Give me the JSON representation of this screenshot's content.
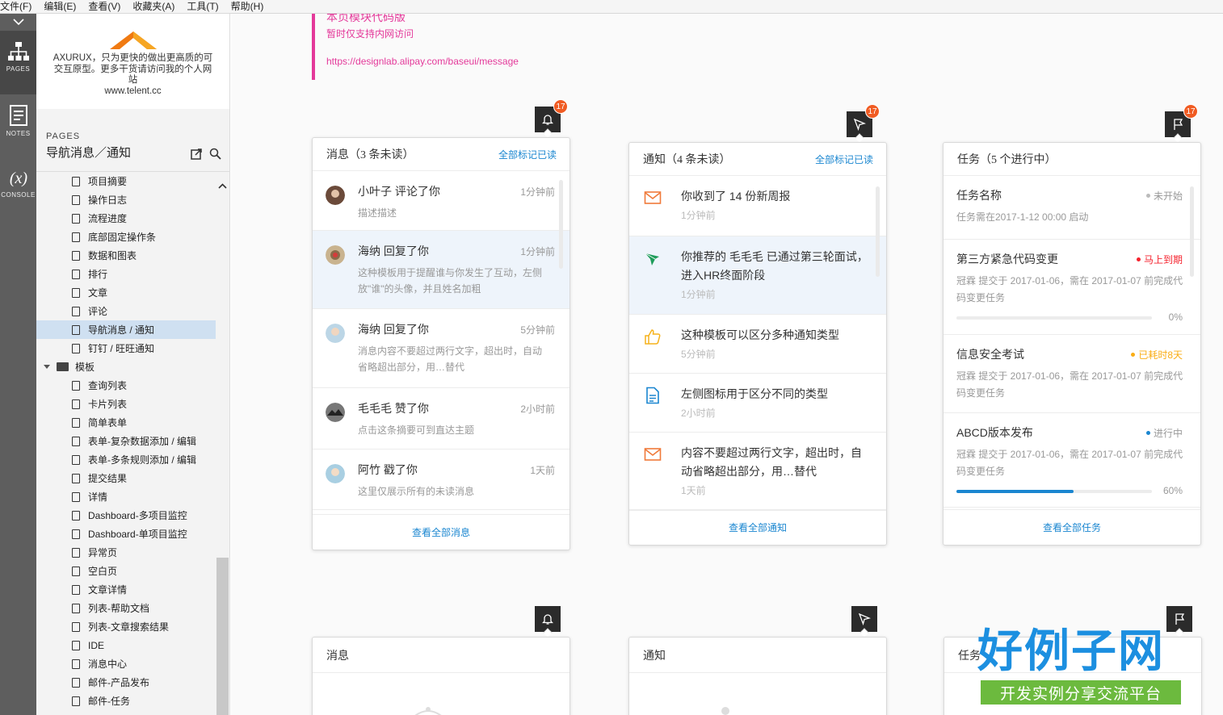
{
  "menubar": {
    "items": [
      "文件(F)",
      "编辑(E)",
      "查看(V)",
      "收藏夹(A)",
      "工具(T)",
      "帮助(H)"
    ]
  },
  "tools": {
    "pages": "PAGES",
    "notes": "NOTES",
    "console": "CONSOLE"
  },
  "brand": {
    "desc": "AXURUX，只为更快的做出更高质的可交互原型。更多干货请访问我的个人网站",
    "site": "www.telent.cc"
  },
  "pages": {
    "label": "PAGES",
    "title": "导航消息／通知"
  },
  "tree": {
    "items": [
      "项目摘要",
      "操作日志",
      "流程进度",
      "底部固定操作条",
      "数据和图表",
      "排行",
      "文章",
      "评论",
      "导航消息 / 通知",
      "钉钉 / 旺旺通知"
    ],
    "folder": "模板",
    "items2": [
      "查询列表",
      "卡片列表",
      "简单表单",
      "表单-复杂数据添加 / 编辑",
      "表单-多条规则添加 / 编辑",
      "提交结果",
      "详情",
      "Dashboard-多项目监控",
      "Dashboard-单项目监控",
      "异常页",
      "空白页",
      "文章详情",
      "列表-帮助文档",
      "列表-文章搜索结果",
      "IDE",
      "消息中心",
      "邮件-产品发布",
      "邮件-任务"
    ]
  },
  "note": {
    "t1": "本页模块代码版",
    "t2": "暂时仅支持内网访问",
    "t3": "https://designlab.alipay.com/baseui/message"
  },
  "badge": "17",
  "messages": {
    "title": "消息（3 条未读）",
    "action": "全部标记已读",
    "footer": "查看全部消息",
    "items": [
      {
        "name": "小叶子 评论了你",
        "time": "1分钟前",
        "desc": "描述描述"
      },
      {
        "name": "海纳 回复了你",
        "time": "1分钟前",
        "desc": "这种模板用于提醒谁与你发生了互动，左侧放\"谁\"的头像，并且姓名加粗"
      },
      {
        "name": "海纳 回复了你",
        "time": "5分钟前",
        "desc": "消息内容不要超过两行文字，超出时，自动省略超出部分，用…替代"
      },
      {
        "name": "毛毛毛 赞了你",
        "time": "2小时前",
        "desc": "点击这条摘要可到直达主题"
      },
      {
        "name": "阿竹 戳了你",
        "time": "1天前",
        "desc": "这里仅展示所有的未读消息"
      }
    ]
  },
  "notices": {
    "title": "通知（4 条未读）",
    "action": "全部标记已读",
    "footer": "查看全部通知",
    "items": [
      {
        "text": "你收到了 14 份新周报",
        "time": "1分钟前"
      },
      {
        "text": "你推荐的 毛毛毛 已通过第三轮面试，进入HR终面阶段",
        "time": "1分钟前"
      },
      {
        "text": "这种模板可以区分多种通知类型",
        "time": "5分钟前"
      },
      {
        "text": "左侧图标用于区分不同的类型",
        "time": "2小时前"
      },
      {
        "text": "内容不要超过两行文字，超出时，自动省略超出部分，用…替代",
        "time": "1天前"
      }
    ]
  },
  "tasks": {
    "title": "任务（5 个进行中）",
    "footer": "查看全部任务",
    "items": [
      {
        "name": "任务名称",
        "status": "未开始",
        "status_color": "#bbbbbb",
        "desc": "任务需在2017-1-12 00:00 启动"
      },
      {
        "name": "第三方紧急代码变更",
        "status": "马上到期",
        "status_color": "#f5222d",
        "desc": "冠霖 提交于 2017-01-06，需在 2017-01-07 前完成代码变更任务",
        "progress": "0%",
        "progress_value": 0
      },
      {
        "name": "信息安全考试",
        "status": "已耗时8天",
        "status_color": "#faad14",
        "desc": "冠霖 提交于 2017-01-06，需在 2017-01-07 前完成代码变更任务"
      },
      {
        "name": "ABCD版本发布",
        "status": "进行中",
        "status_color": "#1a86d0",
        "desc": "冠霖 提交于 2017-01-06，需在 2017-01-07 前完成代码变更任务",
        "progress": "60%",
        "progress_value": 0.6
      }
    ]
  },
  "empty_cards": {
    "messages": "消息",
    "notices": "通知",
    "tasks": "任务"
  },
  "watermark": {
    "w1": "好例子网",
    "w2": "开发实例分享交流平台"
  },
  "colors": {
    "accent": "#1a86d0",
    "badge": "#f05b22",
    "note": "#e4399a"
  }
}
